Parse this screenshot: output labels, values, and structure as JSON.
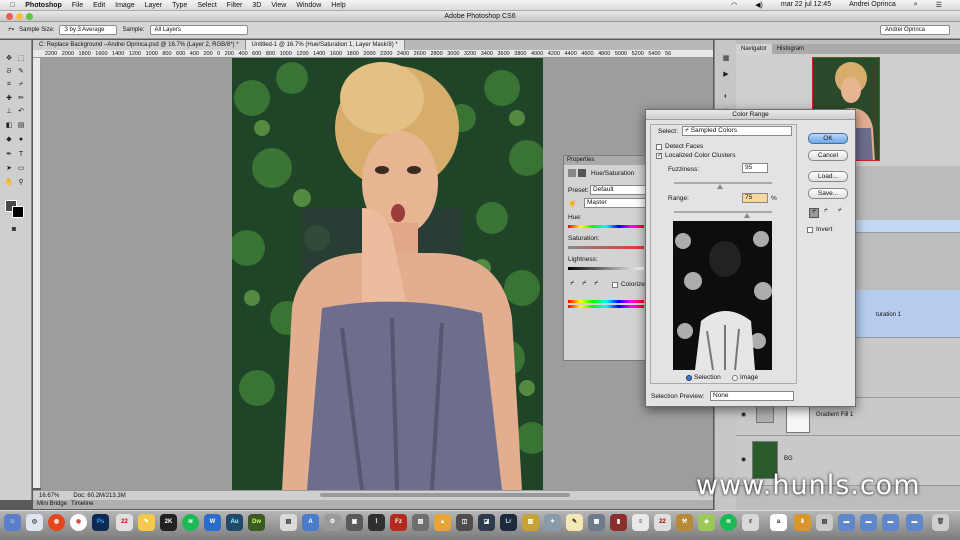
{
  "menubar": {
    "apple": "",
    "app": "Photoshop",
    "items": [
      "File",
      "Edit",
      "Image",
      "Layer",
      "Type",
      "Select",
      "Filter",
      "3D",
      "View",
      "Window",
      "Help"
    ],
    "clock": "mar 22 jul  12:45",
    "user": "Andrei Oprinca"
  },
  "window": {
    "title": "Adobe Photoshop CS6"
  },
  "options": {
    "sample_size_label": "Sample Size:",
    "sample_size_value": "3 by 3 Average",
    "sample_label": "Sample:",
    "sample_value": "All Layers",
    "workspace_value": "Andrei Oprinca"
  },
  "doc_tabs": [
    "C: Replace Background –Andrei Oprinca.psd @ 16.7% (Layer 2, RGB/8*) *",
    "Untitled-1 @ 16.7% (Hue/Saturation 1, Layer Mask/8) *"
  ],
  "ruler": "2200 2000 1800 1600 1400 1200 1000 800 600 400 200 0 200 400 600 800 1000 1200 1400 1600 1800 2000 2200 2400 2600 2800 3000 3200 3400 3600 3800 4000 4200 4400 4600 4800 5000 5200 5400 56",
  "status": {
    "zoom": "16.67%",
    "doc": "Doc: 60.2M/213.3M"
  },
  "bottom_tabs": [
    "Mini Bridge",
    "Timeline"
  ],
  "panels": {
    "nav_tabs": [
      "Navigator",
      "Histogram"
    ],
    "layers": {
      "gradient_fill": "Gradient Fill 1",
      "bg": "BG",
      "hue_layer_partial": "turation 1"
    }
  },
  "properties": {
    "title": "Properties",
    "adj_label": "Hue/Saturation",
    "preset_label": "Preset:",
    "preset_value": "Default",
    "channel_value": "Master",
    "hue_label": "Hue:",
    "saturation_label": "Saturation:",
    "lightness_label": "Lightness:",
    "colorize_label": "Colorize"
  },
  "color_range": {
    "title": "Color Range",
    "select_label": "Select:",
    "select_value": "Sampled Colors",
    "detect_faces": "Detect Faces",
    "detect_faces_checked": false,
    "localized": "Localized Color Clusters",
    "localized_checked": true,
    "fuzziness_label": "Fuzziness:",
    "fuzziness_value": "95",
    "range_label": "Range:",
    "range_value": "75",
    "range_unit": "%",
    "selection_radio": "Selection",
    "image_radio": "Image",
    "selected_radio": "Selection",
    "preview_label": "Selection Preview:",
    "preview_value": "None",
    "ok": "OK",
    "cancel": "Cancel",
    "load": "Load...",
    "save": "Save...",
    "invert": "Invert",
    "invert_checked": false
  },
  "watermark": "www.hunls.com",
  "dock": {
    "labels": [
      "Ps",
      "2K",
      "W",
      "Au",
      "Dw",
      "Lr"
    ]
  }
}
